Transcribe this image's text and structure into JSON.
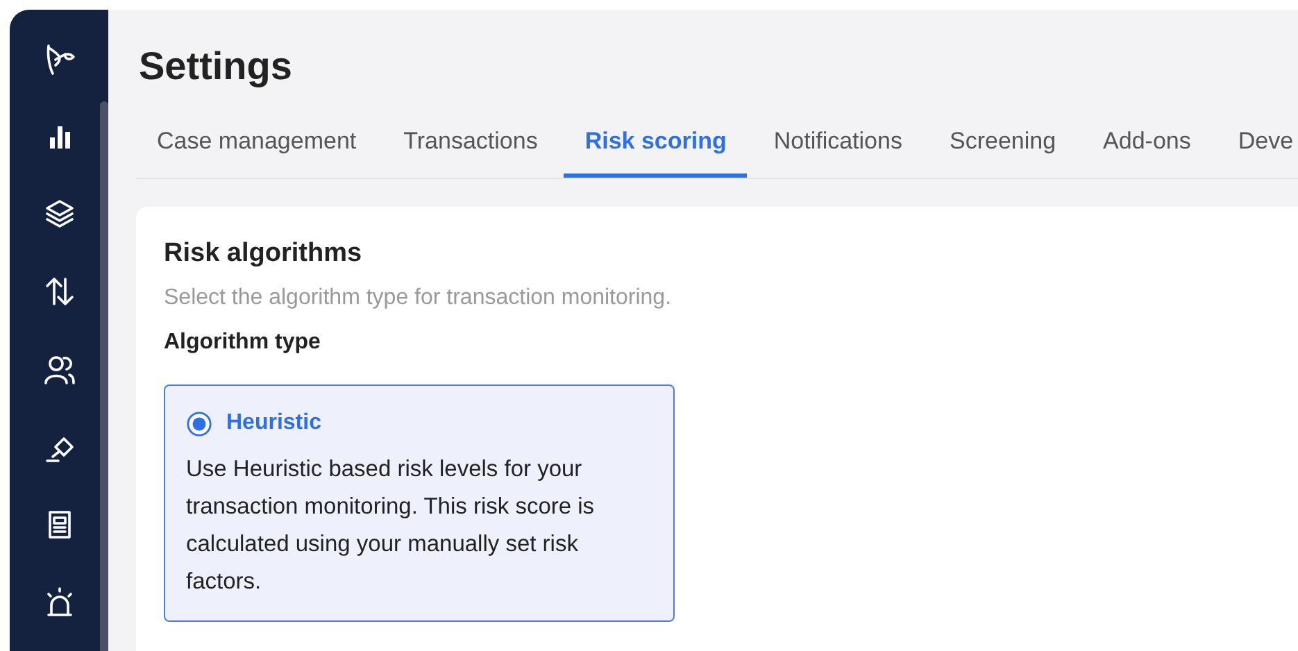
{
  "page": {
    "title": "Settings"
  },
  "tabs": [
    {
      "label": "Case management",
      "selected": false
    },
    {
      "label": "Transactions",
      "selected": false
    },
    {
      "label": "Risk scoring",
      "selected": true
    },
    {
      "label": "Notifications",
      "selected": false
    },
    {
      "label": "Screening",
      "selected": false
    },
    {
      "label": "Add-ons",
      "selected": false
    },
    {
      "label": "Deve",
      "selected": false
    }
  ],
  "section": {
    "title": "Risk algorithms",
    "description": "Select the algorithm type for transaction monitoring.",
    "field_label": "Algorithm type",
    "options": [
      {
        "label": "Heuristic",
        "selected": true,
        "description": "Use Heuristic based risk levels for your transaction monitoring. This risk score is calculated using your manually set risk factors."
      }
    ]
  }
}
